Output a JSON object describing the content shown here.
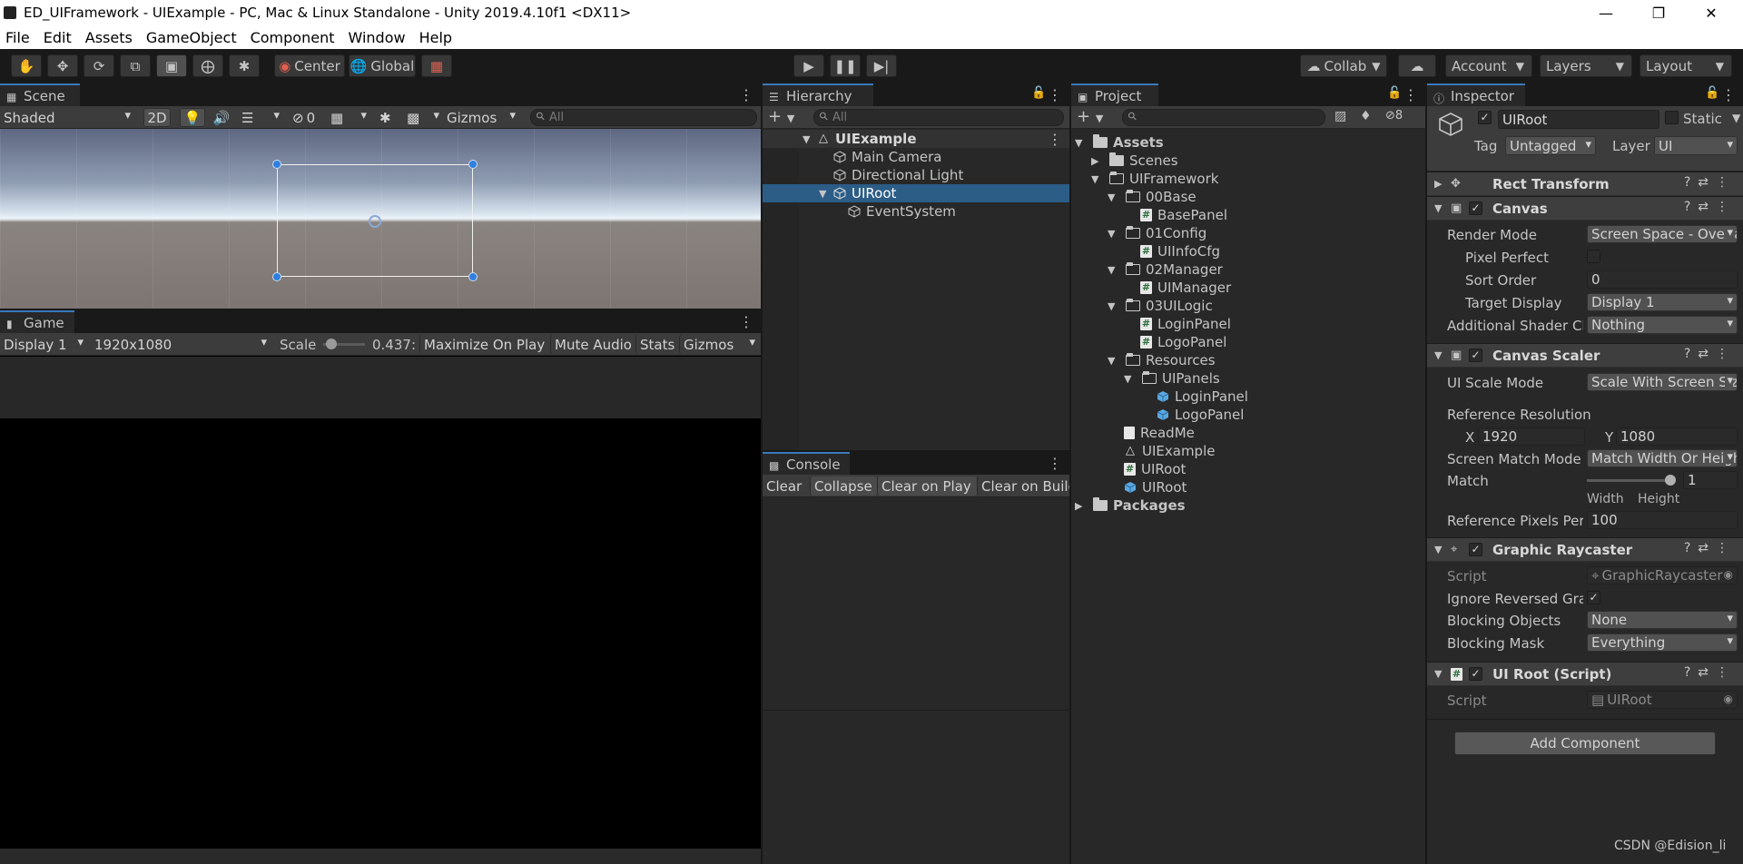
{
  "window": {
    "title": "ED_UIFramework - UIExample - PC, Mac & Linux Standalone - Unity 2019.4.10f1 <DX11>"
  },
  "menu": [
    "File",
    "Edit",
    "Assets",
    "GameObject",
    "Component",
    "Window",
    "Help"
  ],
  "toolbar": {
    "pivot": "Center",
    "space": "Global",
    "collab": "Collab",
    "account": "Account",
    "layers": "Layers",
    "layout": "Layout"
  },
  "scene": {
    "tab": "Scene",
    "shading": "Shaded",
    "mode2d": "2D",
    "hidden_count": "0",
    "gizmos": "Gizmos",
    "search_placeholder": "All"
  },
  "game": {
    "tab": "Game",
    "display": "Display 1",
    "resolution": "1920x1080",
    "scale_label": "Scale",
    "scale_value": "0.437:",
    "scale_fraction": 0.2,
    "maximize": "Maximize On Play",
    "mute": "Mute Audio",
    "stats": "Stats",
    "gizmos": "Gizmos"
  },
  "hierarchy": {
    "tab": "Hierarchy",
    "search_placeholder": "All",
    "scene": "UIExample",
    "items": [
      "Main Camera",
      "Directional Light",
      "UIRoot",
      "EventSystem"
    ]
  },
  "console": {
    "tab": "Console",
    "buttons": [
      "Clear",
      "Collapse",
      "Clear on Play",
      "Clear on Build"
    ]
  },
  "project": {
    "tab": "Project",
    "hidden_count": "8",
    "tree": {
      "assets": "Assets",
      "scenes": "Scenes",
      "uiframework": "UIFramework",
      "base": "00Base",
      "basepanel": "BasePanel",
      "config": "01Config",
      "uiinfocfg": "UIInfoCfg",
      "manager": "02Manager",
      "uimanager": "UIManager",
      "uilogic": "03UILogic",
      "loginpanel": "LoginPanel",
      "logopanel": "LogoPanel",
      "resources": "Resources",
      "uipanels": "UIPanels",
      "loginprefab": "LoginPanel",
      "logoprefab": "LogoPanel",
      "readme": "ReadMe",
      "uiexample": "UIExample",
      "uiroot_script": "UIRoot",
      "uiroot_prefab": "UIRoot",
      "packages": "Packages"
    }
  },
  "inspector": {
    "tab": "Inspector",
    "object_name": "UIRoot",
    "static_label": "Static",
    "tag_label": "Tag",
    "tag_value": "Untagged",
    "layer_label": "Layer",
    "layer_value": "UI",
    "rect_transform": "Rect Transform",
    "canvas": {
      "title": "Canvas",
      "render_mode_label": "Render Mode",
      "render_mode": "Screen Space - Overlay",
      "pixel_perfect": "Pixel Perfect",
      "sort_order_label": "Sort Order",
      "sort_order": "0",
      "target_display_label": "Target Display",
      "target_display": "Display 1",
      "shader_label": "Additional Shader Channels",
      "shader_value": "Nothing"
    },
    "scaler": {
      "title": "Canvas Scaler",
      "scale_mode_label": "UI Scale Mode",
      "scale_mode": "Scale With Screen Size",
      "ref_res_label": "Reference Resolution",
      "x_label": "X",
      "x": "1920",
      "y_label": "Y",
      "y": "1080",
      "match_mode_label": "Screen Match Mode",
      "match_mode": "Match Width Or Height",
      "match_label": "Match",
      "match_value": "1",
      "match_fraction": 1,
      "width_label": "Width",
      "height_label": "Height",
      "ppu_label": "Reference Pixels Per Unit",
      "ppu": "100"
    },
    "raycaster": {
      "title": "Graphic Raycaster",
      "script_label": "Script",
      "script": "GraphicRaycaster",
      "ignore_label": "Ignore Reversed Graphics",
      "blocking_label": "Blocking Objects",
      "blocking": "None",
      "mask_label": "Blocking Mask",
      "mask": "Everything"
    },
    "uiroot_script": {
      "title": "UI Root (Script)",
      "script_label": "Script",
      "script": "UIRoot"
    },
    "add_component": "Add Component"
  },
  "watermark": "CSDN @Edision_li",
  "colors": {
    "selection": "#2c5d87",
    "accent": "#3a79bb",
    "panel": "#282828"
  }
}
